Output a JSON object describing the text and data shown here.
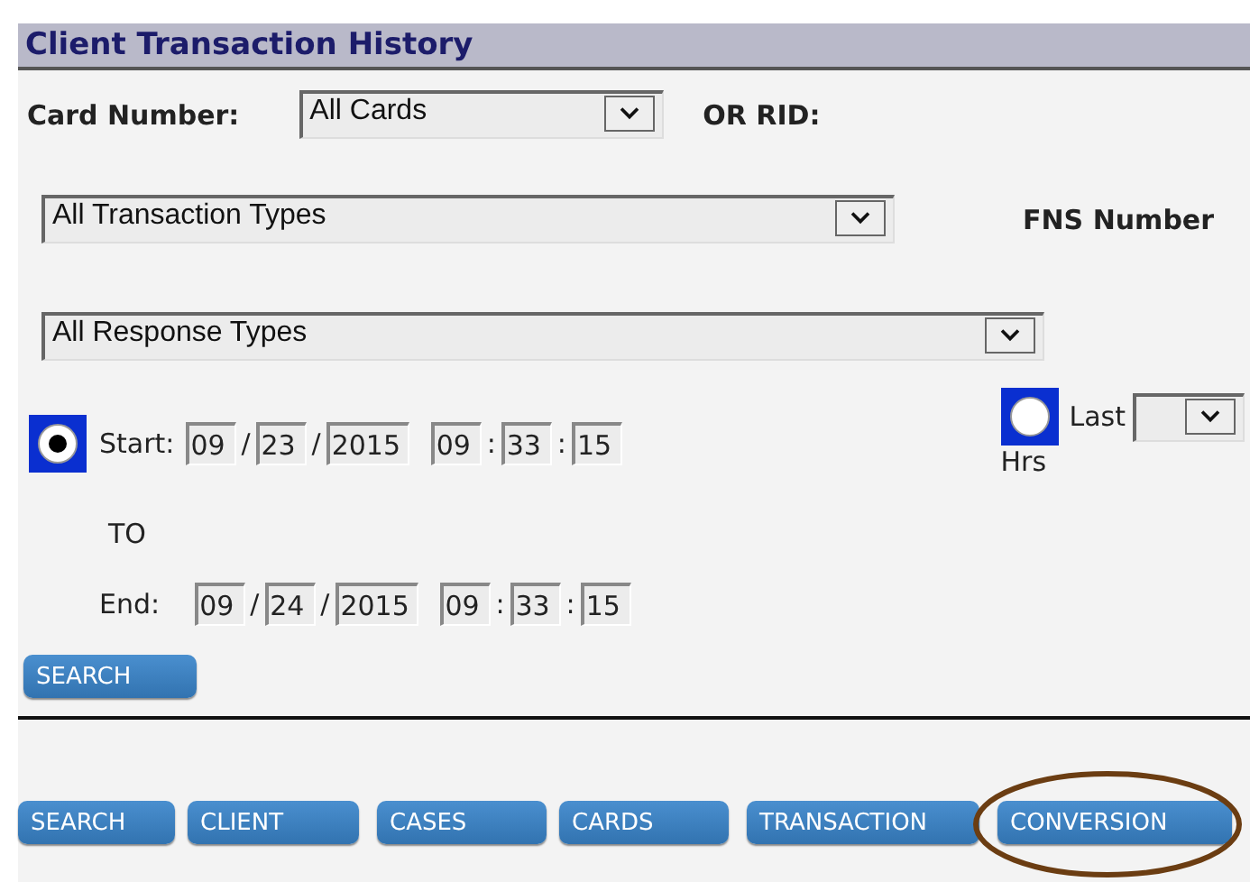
{
  "title": "Client Transaction History",
  "card_row": {
    "label": "Card Number:",
    "select": "All Cards",
    "or_label": "OR  RID:"
  },
  "transaction_row": {
    "select": "All Transaction Types",
    "fns_label": "FNS Number"
  },
  "response_row": {
    "select": "All Response Types"
  },
  "start": {
    "radio_selected": true,
    "label": "Start:",
    "parts": [
      {
        "kind": "field",
        "text": "09"
      },
      {
        "kind": "sep",
        "text": "/"
      },
      {
        "kind": "field",
        "text": "23"
      },
      {
        "kind": "sep",
        "text": "/"
      },
      {
        "kind": "year",
        "text": "2015"
      },
      {
        "kind": "gap"
      },
      {
        "kind": "field",
        "text": "09"
      },
      {
        "kind": "sep",
        "text": ":"
      },
      {
        "kind": "field",
        "text": "33"
      },
      {
        "kind": "sep",
        "text": ":"
      },
      {
        "kind": "field",
        "text": "15"
      }
    ]
  },
  "last": {
    "radio_selected": false,
    "label": "Last",
    "unit": "Hrs"
  },
  "to_label": "TO",
  "end": {
    "label": "End:",
    "parts": [
      {
        "kind": "field",
        "text": "09"
      },
      {
        "kind": "sep",
        "text": "/"
      },
      {
        "kind": "field",
        "text": "24"
      },
      {
        "kind": "sep",
        "text": "/"
      },
      {
        "kind": "year",
        "text": "2015"
      },
      {
        "kind": "gap"
      },
      {
        "kind": "field",
        "text": "09"
      },
      {
        "kind": "sep",
        "text": ":"
      },
      {
        "kind": "field",
        "text": "33"
      },
      {
        "kind": "sep",
        "text": ":"
      },
      {
        "kind": "field",
        "text": "15"
      }
    ]
  },
  "search_button": "SEARCH",
  "nav_buttons": [
    {
      "label": "SEARCH",
      "highlighted": false
    },
    {
      "label": "CLIENT",
      "highlighted": false
    },
    {
      "label": "CASES",
      "highlighted": false
    },
    {
      "label": "CARDS",
      "highlighted": false
    },
    {
      "label": "TRANSACTION",
      "highlighted": false
    },
    {
      "label": "CONVERSION",
      "highlighted": true
    }
  ]
}
